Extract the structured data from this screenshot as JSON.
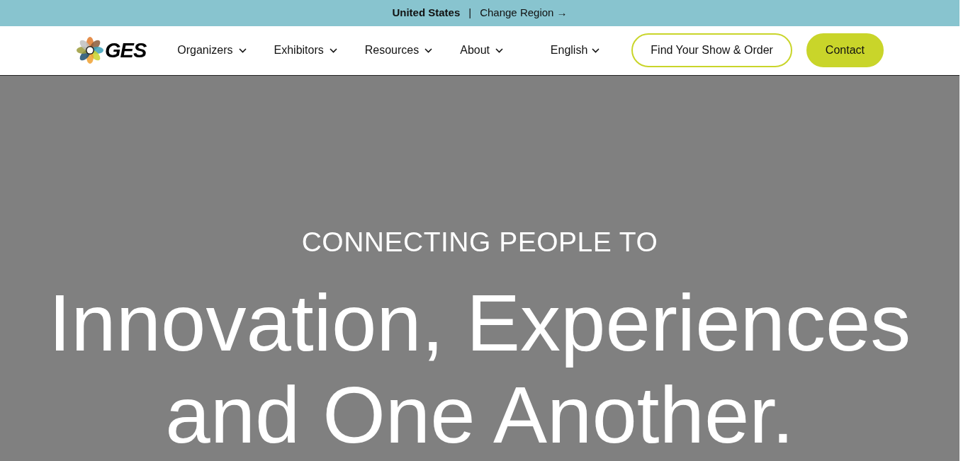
{
  "region_bar": {
    "country": "United States",
    "separator": "|",
    "link": "Change Region",
    "link_arrow": "→"
  },
  "header": {
    "logo_text": "GES",
    "nav": [
      {
        "label": "Organizers"
      },
      {
        "label": "Exhibitors"
      },
      {
        "label": "Resources"
      },
      {
        "label": "About"
      }
    ],
    "language": "English",
    "buttons": [
      {
        "label": "Find Your Show & Order",
        "kind": "outline"
      },
      {
        "label": "Contact",
        "kind": "filled"
      }
    ]
  },
  "hero": {
    "eyebrow": "CONNECTING PEOPLE TO",
    "headline_lines": [
      "Innovation, Experiences",
      "and One Another."
    ]
  }
}
